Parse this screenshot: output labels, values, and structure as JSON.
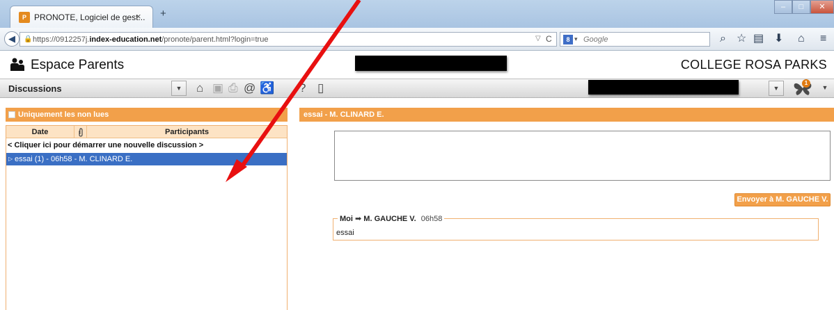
{
  "browser": {
    "tab_title": "PRONOTE, Logiciel de gest...",
    "tab_close": "×",
    "new_tab": "+",
    "url_prefix": "https://0912257j.",
    "url_domain": "index-education.net",
    "url_path": "/pronote/parent.html?login=true",
    "search_placeholder": "Google"
  },
  "app": {
    "title": "Espace Parents",
    "school": "COLLEGE ROSA PARKS"
  },
  "toolbar": {
    "section": "Discussions",
    "notification_count": "1"
  },
  "left_panel": {
    "filter_label": "Uniquement les non lues",
    "columns": {
      "date": "Date",
      "participants": "Participants"
    },
    "new_discussion": "< Cliquer ici pour démarrer une nouvelle discussion >",
    "discussions": [
      {
        "label": "essai (1)  - 06h58 - M. CLINARD E."
      }
    ]
  },
  "right_panel": {
    "title": "essai - M. CLINARD E.",
    "send_label": "Envoyer à M. GAUCHE V.",
    "message": {
      "from": "Moi",
      "arrow": "➡",
      "to": "M. GAUCHE V.",
      "time": "06h58",
      "body": "essai"
    }
  },
  "colors": {
    "accent_orange": "#f2a04a",
    "selection_blue": "#3a6fc4",
    "annotation_red": "#e81010"
  }
}
